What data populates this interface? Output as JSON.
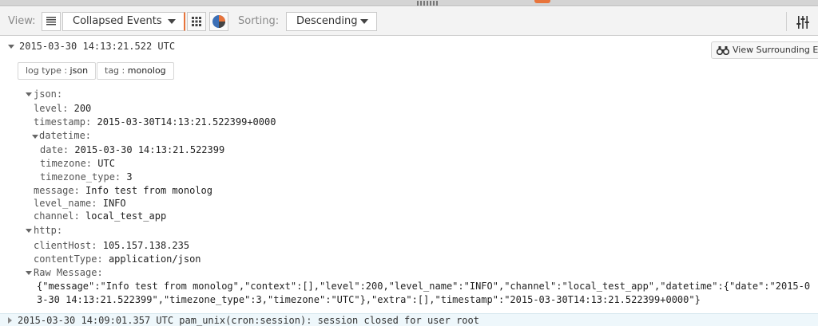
{
  "toolbar": {
    "view_label": "View:",
    "view_mode": "Collapsed Events",
    "sorting_label": "Sorting:",
    "sort_order": "Descending",
    "accent": "#e8743b"
  },
  "event": {
    "timestamp": "2015-03-30 14:13:21.522 UTC",
    "surround_button": "View Surrounding Events",
    "tags": [
      {
        "key": "log type",
        "value": "json"
      },
      {
        "key": "tag",
        "value": "monolog"
      }
    ],
    "json_label": "json:",
    "fields": {
      "level": {
        "k": "level:",
        "v": "200"
      },
      "timestamp": {
        "k": "timestamp:",
        "v": "2015-03-30T14:13:21.522399+0000"
      },
      "datetime_label": "datetime:",
      "date": {
        "k": "date:",
        "v": "2015-03-30 14:13:21.522399"
      },
      "timezone": {
        "k": "timezone:",
        "v": "UTC"
      },
      "timezone_type": {
        "k": "timezone_type:",
        "v": "3"
      },
      "message": {
        "k": "message:",
        "v": "Info test from monolog"
      },
      "level_name": {
        "k": "level_name:",
        "v": "INFO"
      },
      "channel": {
        "k": "channel:",
        "v": "local_test_app"
      }
    },
    "http_label": "http:",
    "http": {
      "clientHost": {
        "k": "clientHost:",
        "v": "105.157.138.235"
      },
      "contentType": {
        "k": "contentType:",
        "v": "application/json"
      }
    },
    "raw_label": "Raw Message:",
    "raw_message": "{\"message\":\"Info test from monolog\",\"context\":[],\"level\":200,\"level_name\":\"INFO\",\"channel\":\"local_test_app\",\"datetime\":{\"date\":\"2015-03-30 14:13:21.522399\",\"timezone_type\":3,\"timezone\":\"UTC\"},\"extra\":[],\"timestamp\":\"2015-03-30T14:13:21.522399+0000\"}"
  },
  "next_event": {
    "summary": "2015-03-30 14:09:01.357 UTC pam_unix(cron:session): session closed for user root"
  }
}
